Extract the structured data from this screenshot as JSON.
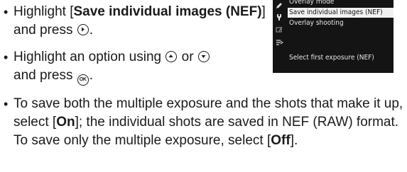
{
  "bullets": [
    {
      "text_a": "Highlight [",
      "bold": "Save individual images (NEF)",
      "text_b": "] and press",
      "icons": [
        "multi-selector-right-icon"
      ],
      "text_c": "."
    },
    {
      "text_a": "Highlight an option using",
      "icons": [
        "multi-selector-up-icon",
        "multi-selector-down-icon",
        "ok-button-icon"
      ],
      "connector_1": "or",
      "text_b": "and press",
      "text_c": "."
    },
    {
      "text_a": "To save both the multiple exposure and the shots that make it up, select [",
      "bold_1": "On",
      "text_b": "]; the individual shots are saved in NEF (RAW) format. To save only the multiple exposure, select [",
      "bold_2": "Off",
      "text_c": "]."
    }
  ],
  "camera_menu": {
    "items": [
      "Overlay mode",
      "Save individual images (NEF)",
      "Overlay shooting",
      "",
      "Select first exposure (NEF)"
    ],
    "selected_index": 1,
    "side_icons": [
      "pencil-icon",
      "wrench-icon",
      "retouch-icon",
      "my-menu-icon"
    ],
    "colors": {
      "background": "#141414",
      "highlight": "#f1f1f1",
      "text": "#e8e8e8"
    }
  },
  "ok_label": "OK"
}
